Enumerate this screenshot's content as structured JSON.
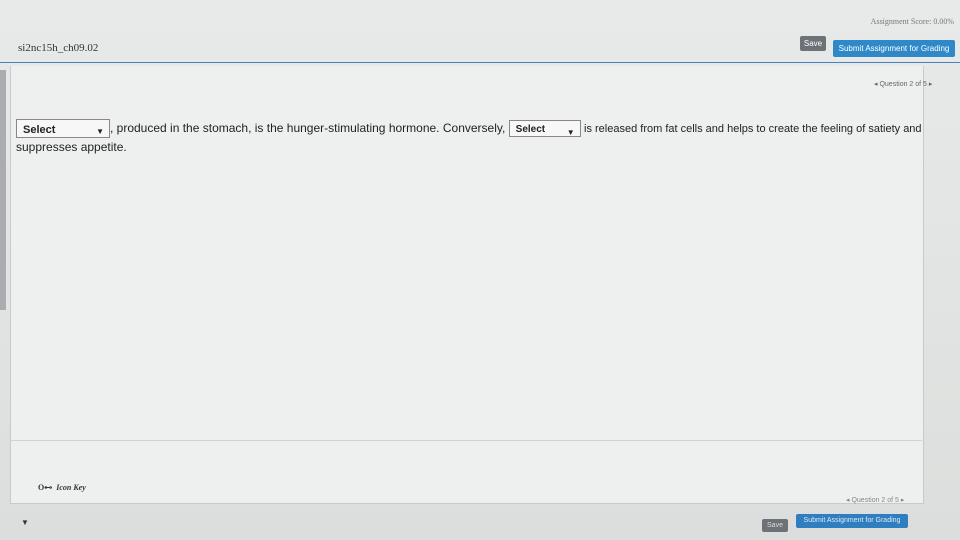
{
  "header": {
    "assignment_score": "Assignment Score: 0.00%",
    "save_label": "Save",
    "submit_label": "Submit Assignment for Grading",
    "course_id": "si2nc15h_ch09.02",
    "question_nav": "◂ Question 2 of 5 ▸"
  },
  "question": {
    "select1_value": "Select",
    "text1": ", produced in the stomach, is the hunger-stimulating hormone. Conversely,",
    "select2_value": "Select",
    "text2": "is released from fat cells and helps to create the feeling of satiety and",
    "text3": "suppresses appetite."
  },
  "footer": {
    "icon_key_label": "Icon Key",
    "question_nav": "◂ Question 2 of 5 ▸",
    "save_label": "Save",
    "submit_label": "Submit Assignment for Grading"
  },
  "icons": {
    "key": "key-icon",
    "dropdown": "chevron-down-icon",
    "scroll": "scroll-down-arrow-icon"
  },
  "colors": {
    "submit_button": "#2f89c9",
    "save_button": "#6d7277",
    "header_rule": "#4c7fc0"
  }
}
